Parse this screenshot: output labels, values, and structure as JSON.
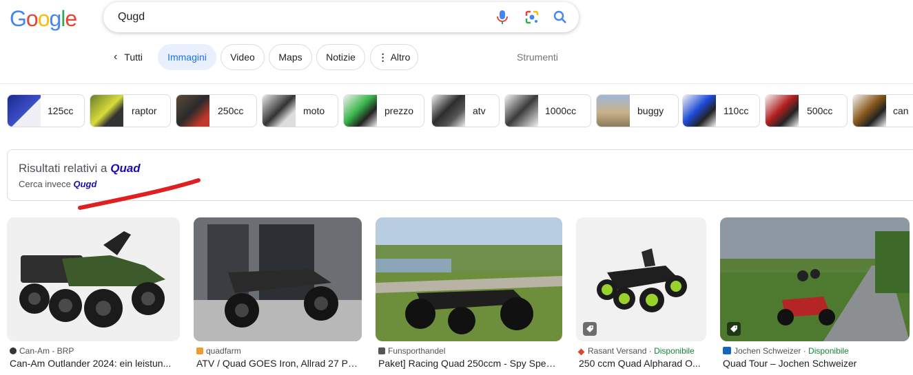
{
  "logo_text": "Google",
  "search": {
    "query": "Qugd"
  },
  "tabs": [
    {
      "label": "Tutti"
    },
    {
      "label": "Immagini"
    },
    {
      "label": "Video"
    },
    {
      "label": "Maps"
    },
    {
      "label": "Notizie"
    },
    {
      "label": "Altro"
    }
  ],
  "tools_label": "Strumenti",
  "chips": [
    "125cc",
    "raptor",
    "250cc",
    "moto",
    "prezzo",
    "atv",
    "1000cc",
    "buggy",
    "110cc",
    "500cc",
    "can"
  ],
  "correction": {
    "prefix": "Risultati relativi a ",
    "corrected": "Quad",
    "instead_prefix": "Cerca invece ",
    "original": "Qugd"
  },
  "results": [
    {
      "source": "Can-Am - BRP",
      "availability": "",
      "title": "Can-Am Outlander 2024: ein leistun..."
    },
    {
      "source": "quadfarm",
      "availability": "",
      "title": "ATV / Quad GOES Iron, Allrad 27 PS..."
    },
    {
      "source": "Funsporthandel",
      "availability": "",
      "title": "Paket] Racing Quad 250ccm - Spy Spee..."
    },
    {
      "source": "Rasant Versand · ",
      "availability": "Disponibile",
      "title": "250 ccm Quad Alpharad O..."
    },
    {
      "source": "Jochen Schweizer · ",
      "availability": "Disponibile",
      "title": "Quad Tour – Jochen Schweizer"
    }
  ],
  "colors": {
    "accent": "#1a73e8",
    "link": "#1a0dab",
    "available": "#188038"
  }
}
